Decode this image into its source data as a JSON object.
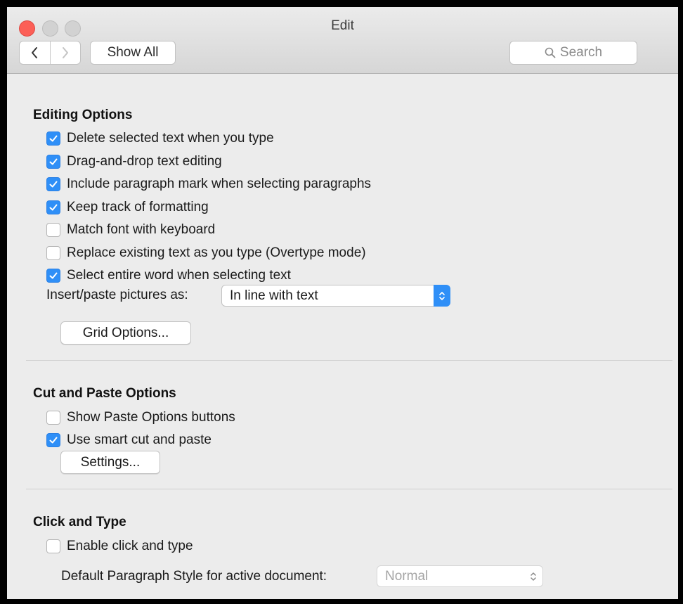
{
  "window": {
    "title": "Edit"
  },
  "toolbar": {
    "show_all_label": "Show All",
    "search_placeholder": "Search"
  },
  "editing": {
    "title": "Editing Options",
    "options": [
      {
        "label": "Delete selected text when you type",
        "checked": true
      },
      {
        "label": "Drag-and-drop text editing",
        "checked": true
      },
      {
        "label": "Include paragraph mark when selecting paragraphs",
        "checked": true
      },
      {
        "label": "Keep track of formatting",
        "checked": true
      },
      {
        "label": "Match font with keyboard",
        "checked": false
      },
      {
        "label": "Replace existing text as you type (Overtype mode)",
        "checked": false
      },
      {
        "label": "Select entire word when selecting text",
        "checked": true
      }
    ],
    "insert_label": "Insert/paste pictures as:",
    "insert_value": "In line with text",
    "grid_button": "Grid Options..."
  },
  "cutpaste": {
    "title": "Cut and Paste Options",
    "options": [
      {
        "label": "Show Paste Options buttons",
        "checked": false
      },
      {
        "label": "Use smart cut and paste",
        "checked": true
      }
    ],
    "settings_button": "Settings..."
  },
  "clicktype": {
    "title": "Click and Type",
    "options": [
      {
        "label": "Enable click and type",
        "checked": false
      }
    ],
    "style_label": "Default Paragraph Style for active document:",
    "style_value": "Normal"
  },
  "colors": {
    "accent": "#2f8ff7",
    "close": "#fc5f57"
  }
}
